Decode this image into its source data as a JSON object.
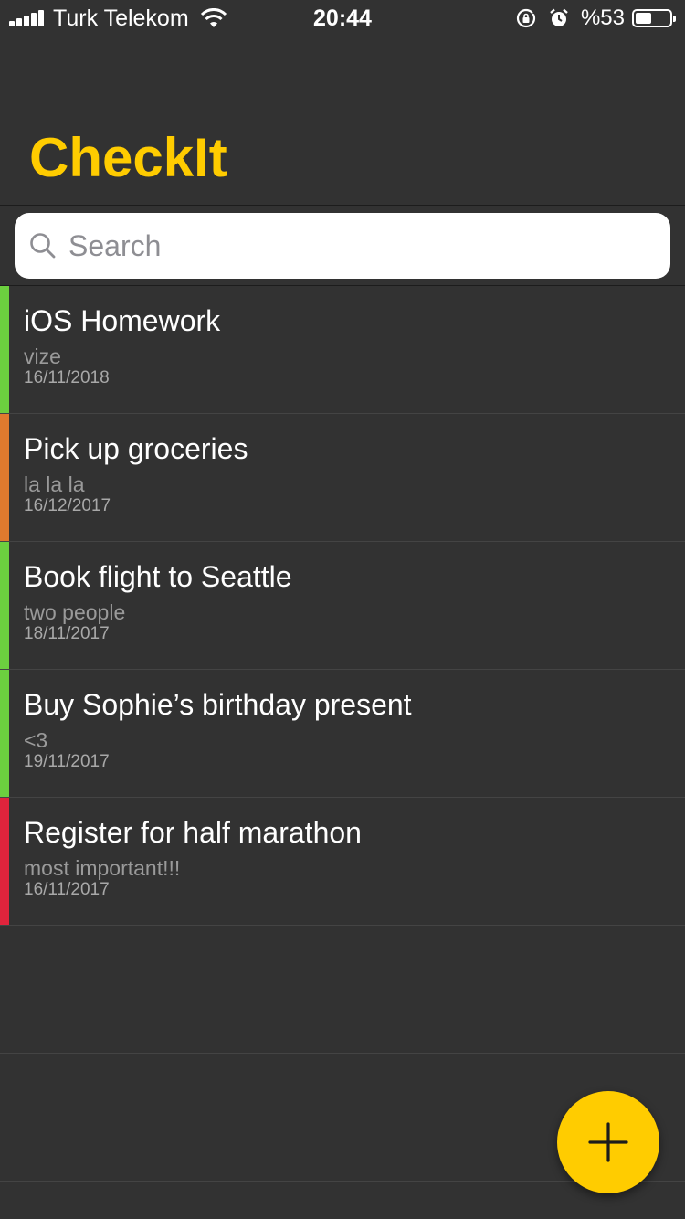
{
  "status_bar": {
    "carrier": "Turk Telekom",
    "time": "20:44",
    "battery": "%53",
    "battery_level": 0.53
  },
  "app": {
    "title": "CheckIt",
    "accent_color": "#ffcc00"
  },
  "search": {
    "placeholder": "Search",
    "value": ""
  },
  "todos": [
    {
      "title": "iOS Homework",
      "note": "vize",
      "date": "16/11/2018",
      "priority_color": "#6ccf3f"
    },
    {
      "title": "Pick up groceries",
      "note": "la la la",
      "date": "16/12/2017",
      "priority_color": "#e07a2e"
    },
    {
      "title": "Book flight to Seattle",
      "note": "two people",
      "date": "18/11/2017",
      "priority_color": "#6ccf3f"
    },
    {
      "title": "Buy Sophie’s birthday present",
      "note": "<3",
      "date": "19/11/2017",
      "priority_color": "#6ccf3f"
    },
    {
      "title": "Register for half marathon",
      "note": "most important!!!",
      "date": "16/11/2017",
      "priority_color": "#e0243c"
    }
  ],
  "fab": {
    "icon": "plus-icon",
    "color": "#ffcc00"
  }
}
